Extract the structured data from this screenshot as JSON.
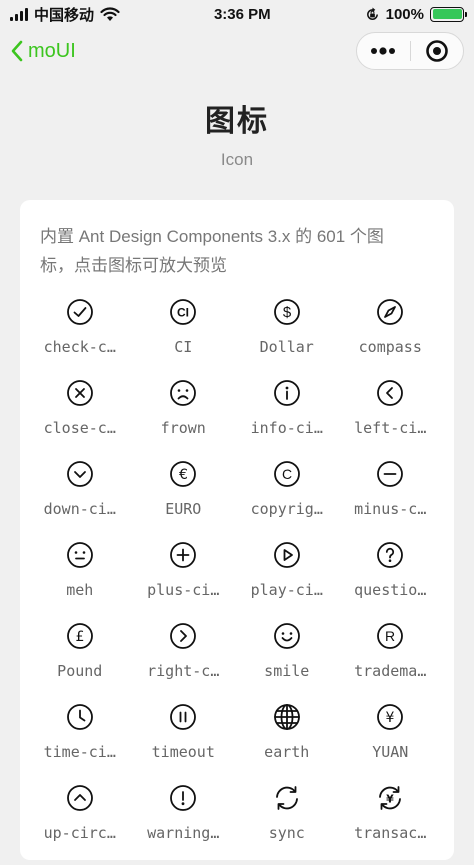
{
  "status_bar": {
    "carrier": "中国移动",
    "time": "3:36 PM",
    "battery": "100%",
    "icons": [
      "signal-icon",
      "wifi-icon",
      "orientation-lock-icon",
      "battery-icon"
    ]
  },
  "nav": {
    "back_label": "moUI",
    "icons": [
      "chevron-left-icon",
      "more-icon",
      "target-icon"
    ]
  },
  "header": {
    "title": "图标",
    "subtitle": "Icon"
  },
  "card": {
    "intro": "内置 Ant Design Components 3.x 的 601 个图标，点击图标可放大预览",
    "icons": [
      {
        "label": "check-c…",
        "icon": "check-circle-icon"
      },
      {
        "label": "CI",
        "icon": "ci-icon"
      },
      {
        "label": "Dollar",
        "icon": "dollar-icon"
      },
      {
        "label": "compass",
        "icon": "compass-icon"
      },
      {
        "label": "close-c…",
        "icon": "close-circle-icon"
      },
      {
        "label": "frown",
        "icon": "frown-icon"
      },
      {
        "label": "info-ci…",
        "icon": "info-circle-icon"
      },
      {
        "label": "left-ci…",
        "icon": "left-circle-icon"
      },
      {
        "label": "down-ci…",
        "icon": "down-circle-icon"
      },
      {
        "label": "EURO",
        "icon": "euro-icon"
      },
      {
        "label": "copyrig…",
        "icon": "copyright-icon"
      },
      {
        "label": "minus-c…",
        "icon": "minus-circle-icon"
      },
      {
        "label": "meh",
        "icon": "meh-icon"
      },
      {
        "label": "plus-ci…",
        "icon": "plus-circle-icon"
      },
      {
        "label": "play-ci…",
        "icon": "play-circle-icon"
      },
      {
        "label": "questio…",
        "icon": "question-circle-icon"
      },
      {
        "label": "Pound",
        "icon": "pound-icon"
      },
      {
        "label": "right-c…",
        "icon": "right-circle-icon"
      },
      {
        "label": "smile",
        "icon": "smile-icon"
      },
      {
        "label": "tradema…",
        "icon": "trademark-icon"
      },
      {
        "label": "time-ci…",
        "icon": "time-circle-icon"
      },
      {
        "label": "timeout",
        "icon": "timeout-icon"
      },
      {
        "label": "earth",
        "icon": "earth-icon"
      },
      {
        "label": "YUAN",
        "icon": "yuan-icon"
      },
      {
        "label": "up-circ…",
        "icon": "up-circle-icon"
      },
      {
        "label": "warning…",
        "icon": "warning-circle-icon"
      },
      {
        "label": "sync",
        "icon": "sync-icon"
      },
      {
        "label": "transac…",
        "icon": "transaction-icon"
      }
    ]
  },
  "colors": {
    "accent": "#3cc51f",
    "background": "#f0f0f0",
    "card": "#ffffff",
    "battery_fill": "#35c759"
  }
}
